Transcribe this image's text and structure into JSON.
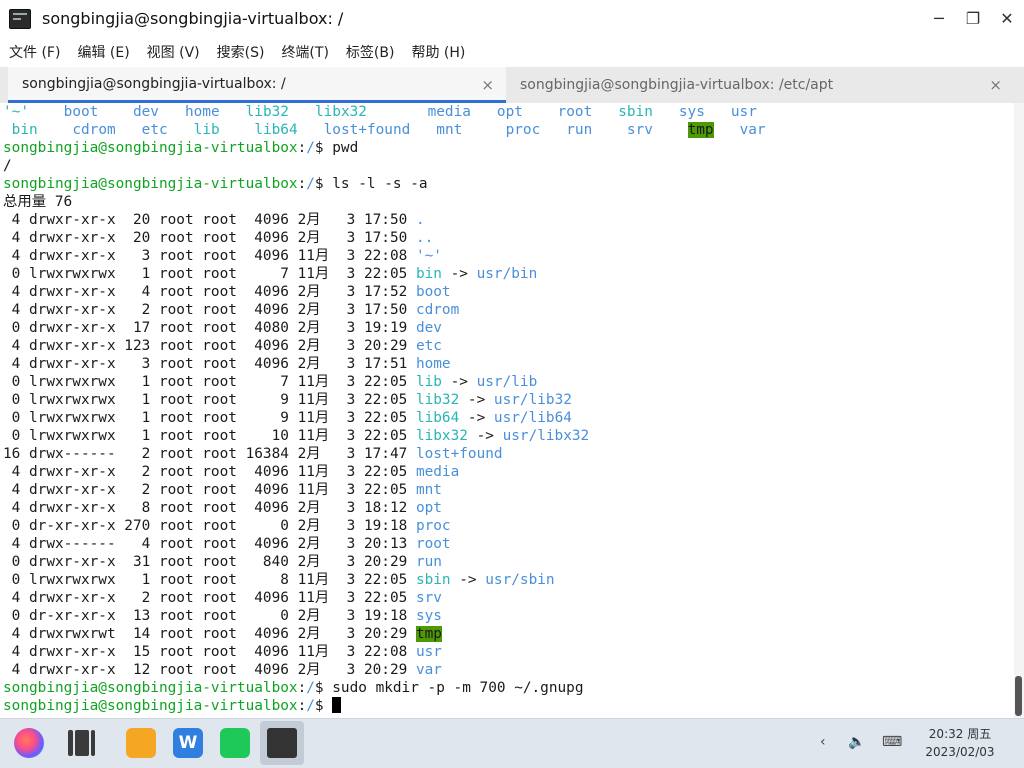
{
  "window": {
    "title": "songbingjia@songbingjia-virtualbox: /",
    "controls": {
      "minimize": "─",
      "restore": "❐",
      "close": "✕"
    }
  },
  "menu": [
    "文件 (F)",
    "编辑 (E)",
    "视图 (V)",
    "搜索(S)",
    "终端(T)",
    "标签(B)",
    "帮助 (H)"
  ],
  "tabs": [
    {
      "label": "songbingjia@songbingjia-virtualbox: /",
      "active": true,
      "close": "×"
    },
    {
      "label": "songbingjia@songbingjia-virtualbox: /etc/apt",
      "active": false,
      "close": "×"
    }
  ],
  "terminal": {
    "lines": [
      [
        {
          "t": "'~'",
          "c": "lnk"
        },
        {
          "t": "    "
        },
        {
          "t": "boot",
          "c": "dir"
        },
        {
          "t": "    "
        },
        {
          "t": "dev",
          "c": "dir"
        },
        {
          "t": "   "
        },
        {
          "t": "home",
          "c": "dir"
        },
        {
          "t": "   "
        },
        {
          "t": "lib32",
          "c": "lnk"
        },
        {
          "t": "   "
        },
        {
          "t": "libx32",
          "c": "lnk"
        },
        {
          "t": "       "
        },
        {
          "t": "media",
          "c": "dir"
        },
        {
          "t": "   "
        },
        {
          "t": "opt",
          "c": "dir"
        },
        {
          "t": "    "
        },
        {
          "t": "root",
          "c": "dir"
        },
        {
          "t": "   "
        },
        {
          "t": "sbin",
          "c": "lnk"
        },
        {
          "t": "   "
        },
        {
          "t": "sys",
          "c": "dir"
        },
        {
          "t": "   "
        },
        {
          "t": "usr",
          "c": "dir"
        }
      ],
      [
        {
          "t": " "
        },
        {
          "t": "bin",
          "c": "lnk"
        },
        {
          "t": "    "
        },
        {
          "t": "cdrom",
          "c": "dir"
        },
        {
          "t": "   "
        },
        {
          "t": "etc",
          "c": "dir"
        },
        {
          "t": "   "
        },
        {
          "t": "lib",
          "c": "lnk"
        },
        {
          "t": "    "
        },
        {
          "t": "lib64",
          "c": "lnk"
        },
        {
          "t": "   "
        },
        {
          "t": "lost+found",
          "c": "dir"
        },
        {
          "t": "   "
        },
        {
          "t": "mnt",
          "c": "dir"
        },
        {
          "t": "     "
        },
        {
          "t": "proc",
          "c": "dir"
        },
        {
          "t": "   "
        },
        {
          "t": "run",
          "c": "dir"
        },
        {
          "t": "    "
        },
        {
          "t": "srv",
          "c": "dir"
        },
        {
          "t": "    "
        },
        {
          "t": "tmp",
          "c": "tmp"
        },
        {
          "t": "   "
        },
        {
          "t": "var",
          "c": "dir"
        }
      ],
      [
        {
          "t": "songbingjia@songbingjia-virtualbox",
          "c": "prompt"
        },
        {
          "t": ":"
        },
        {
          "t": "/",
          "c": "dir"
        },
        {
          "t": "$ pwd"
        }
      ],
      [
        {
          "t": "/"
        }
      ],
      [
        {
          "t": "songbingjia@songbingjia-virtualbox",
          "c": "prompt"
        },
        {
          "t": ":"
        },
        {
          "t": "/",
          "c": "dir"
        },
        {
          "t": "$ ls -l -s -a"
        }
      ],
      [
        {
          "t": "总用量 76"
        }
      ],
      [
        {
          "t": " 4 drwxr-xr-x  20 root root  4096 2月   3 17:50 "
        },
        {
          "t": ".",
          "c": "dir"
        }
      ],
      [
        {
          "t": " 4 drwxr-xr-x  20 root root  4096 2月   3 17:50 "
        },
        {
          "t": "..",
          "c": "dir"
        }
      ],
      [
        {
          "t": " 4 drwxr-xr-x   3 root root  4096 11月  3 22:08 "
        },
        {
          "t": "'~'",
          "c": "dir"
        }
      ],
      [
        {
          "t": " 0 lrwxrwxrwx   1 root root     7 11月  3 22:05 "
        },
        {
          "t": "bin",
          "c": "lnk"
        },
        {
          "t": " -> "
        },
        {
          "t": "usr/bin",
          "c": "dir"
        }
      ],
      [
        {
          "t": " 4 drwxr-xr-x   4 root root  4096 2月   3 17:52 "
        },
        {
          "t": "boot",
          "c": "dir"
        }
      ],
      [
        {
          "t": " 4 drwxr-xr-x   2 root root  4096 2月   3 17:50 "
        },
        {
          "t": "cdrom",
          "c": "dir"
        }
      ],
      [
        {
          "t": " 0 drwxr-xr-x  17 root root  4080 2月   3 19:19 "
        },
        {
          "t": "dev",
          "c": "dir"
        }
      ],
      [
        {
          "t": " 4 drwxr-xr-x 123 root root  4096 2月   3 20:29 "
        },
        {
          "t": "etc",
          "c": "dir"
        }
      ],
      [
        {
          "t": " 4 drwxr-xr-x   3 root root  4096 2月   3 17:51 "
        },
        {
          "t": "home",
          "c": "dir"
        }
      ],
      [
        {
          "t": " 0 lrwxrwxrwx   1 root root     7 11月  3 22:05 "
        },
        {
          "t": "lib",
          "c": "lnk"
        },
        {
          "t": " -> "
        },
        {
          "t": "usr/lib",
          "c": "dir"
        }
      ],
      [
        {
          "t": " 0 lrwxrwxrwx   1 root root     9 11月  3 22:05 "
        },
        {
          "t": "lib32",
          "c": "lnk"
        },
        {
          "t": " -> "
        },
        {
          "t": "usr/lib32",
          "c": "dir"
        }
      ],
      [
        {
          "t": " 0 lrwxrwxrwx   1 root root     9 11月  3 22:05 "
        },
        {
          "t": "lib64",
          "c": "lnk"
        },
        {
          "t": " -> "
        },
        {
          "t": "usr/lib64",
          "c": "dir"
        }
      ],
      [
        {
          "t": " 0 lrwxrwxrwx   1 root root    10 11月  3 22:05 "
        },
        {
          "t": "libx32",
          "c": "lnk"
        },
        {
          "t": " -> "
        },
        {
          "t": "usr/libx32",
          "c": "dir"
        }
      ],
      [
        {
          "t": "16 drwx------   2 root root 16384 2月   3 17:47 "
        },
        {
          "t": "lost+found",
          "c": "dir"
        }
      ],
      [
        {
          "t": " 4 drwxr-xr-x   2 root root  4096 11月  3 22:05 "
        },
        {
          "t": "media",
          "c": "dir"
        }
      ],
      [
        {
          "t": " 4 drwxr-xr-x   2 root root  4096 11月  3 22:05 "
        },
        {
          "t": "mnt",
          "c": "dir"
        }
      ],
      [
        {
          "t": " 4 drwxr-xr-x   8 root root  4096 2月   3 18:12 "
        },
        {
          "t": "opt",
          "c": "dir"
        }
      ],
      [
        {
          "t": " 0 dr-xr-xr-x 270 root root     0 2月   3 19:18 "
        },
        {
          "t": "proc",
          "c": "dir"
        }
      ],
      [
        {
          "t": " 4 drwx------   4 root root  4096 2月   3 20:13 "
        },
        {
          "t": "root",
          "c": "dir"
        }
      ],
      [
        {
          "t": " 0 drwxr-xr-x  31 root root   840 2月   3 20:29 "
        },
        {
          "t": "run",
          "c": "dir"
        }
      ],
      [
        {
          "t": " 0 lrwxrwxrwx   1 root root     8 11月  3 22:05 "
        },
        {
          "t": "sbin",
          "c": "lnk"
        },
        {
          "t": " -> "
        },
        {
          "t": "usr/sbin",
          "c": "dir"
        }
      ],
      [
        {
          "t": " 4 drwxr-xr-x   2 root root  4096 11月  3 22:05 "
        },
        {
          "t": "srv",
          "c": "dir"
        }
      ],
      [
        {
          "t": " 0 dr-xr-xr-x  13 root root     0 2月   3 19:18 "
        },
        {
          "t": "sys",
          "c": "dir"
        }
      ],
      [
        {
          "t": " 4 drwxrwxrwt  14 root root  4096 2月   3 20:29 "
        },
        {
          "t": "tmp",
          "c": "tmp"
        }
      ],
      [
        {
          "t": " 4 drwxr-xr-x  15 root root  4096 11月  3 22:08 "
        },
        {
          "t": "usr",
          "c": "dir"
        }
      ],
      [
        {
          "t": " 4 drwxr-xr-x  12 root root  4096 2月   3 20:29 "
        },
        {
          "t": "var",
          "c": "dir"
        }
      ],
      [
        {
          "t": "songbingjia@songbingjia-virtualbox",
          "c": "prompt"
        },
        {
          "t": ":"
        },
        {
          "t": "/",
          "c": "dir"
        },
        {
          "t": "$ sudo mkdir -p -m 700 ~/.gnupg"
        }
      ],
      [
        {
          "t": "songbingjia@songbingjia-virtualbox",
          "c": "prompt"
        },
        {
          "t": ":"
        },
        {
          "t": "/",
          "c": "dir"
        },
        {
          "t": "$ "
        },
        {
          "t": "",
          "c": "cursor"
        }
      ]
    ]
  },
  "colors": {
    "prompt": "#11a323",
    "dir": "#4a90d9",
    "link": "#2ab5b5",
    "tmp_bg": "#4e9a06",
    "tab_underline": "#2f6fd6"
  },
  "taskbar": {
    "apps": [
      "launcher-icon",
      "file-manager-icon",
      "notes-icon",
      "wps-icon",
      "wechat-icon",
      "terminal-icon"
    ],
    "wps_glyph": "W",
    "tray": {
      "chevron": "‹",
      "volume": "🔈",
      "keyboard": "⌨"
    },
    "clock": {
      "time": "20:32 周五",
      "date": "2023/02/03"
    }
  }
}
